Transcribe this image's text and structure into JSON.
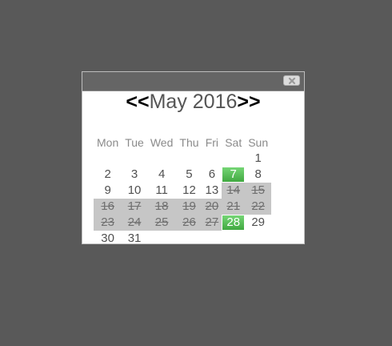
{
  "calendar": {
    "prev_label": "<<",
    "next_label": ">>",
    "month_label": "May 2016",
    "weekdays": [
      "Mon",
      "Tue",
      "Wed",
      "Thu",
      "Fri",
      "Sat",
      "Sun"
    ],
    "weeks": [
      [
        "",
        "",
        "",
        "",
        "",
        "",
        "1"
      ],
      [
        "2",
        "3",
        "4",
        "5",
        "6",
        "7",
        "8"
      ],
      [
        "9",
        "10",
        "11",
        "12",
        "13",
        "14",
        "15"
      ],
      [
        "16",
        "17",
        "18",
        "19",
        "20",
        "21",
        "22"
      ],
      [
        "23",
        "24",
        "25",
        "26",
        "27",
        "28",
        "29"
      ],
      [
        "30",
        "31",
        "",
        "",
        "",
        "",
        ""
      ]
    ],
    "highlighted_days": [
      "7",
      "28"
    ],
    "disabled_days": [
      "14",
      "15",
      "16",
      "17",
      "18",
      "19",
      "20",
      "21",
      "22",
      "23",
      "24",
      "25",
      "26",
      "27"
    ]
  },
  "colors": {
    "backdrop": "#595959",
    "titlebar": "#656565",
    "highlight": "#4cb84c",
    "disabled": "#c6c6c6"
  }
}
